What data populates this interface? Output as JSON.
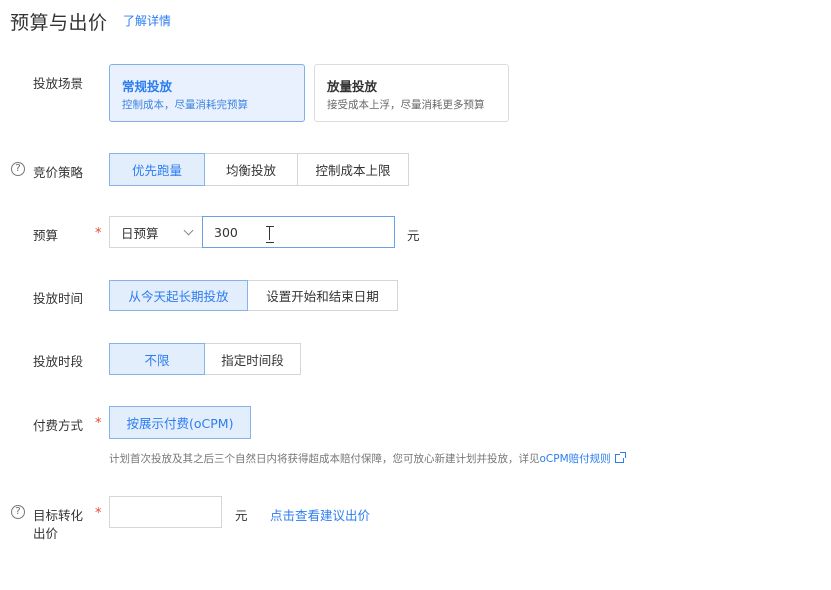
{
  "header": {
    "title": "预算与出价",
    "learn_more": "了解详情"
  },
  "scene": {
    "label": "投放场景",
    "options": [
      {
        "title": "常规投放",
        "subtitle": "控制成本，尽量消耗完预算"
      },
      {
        "title": "放量投放",
        "subtitle": "接受成本上浮，尽量消耗更多预算"
      }
    ],
    "selected": 0
  },
  "strategy": {
    "label": "竞价策略",
    "help_icon": "question-circle-icon",
    "options": [
      "优先跑量",
      "均衡投放",
      "控制成本上限"
    ],
    "selected": 0
  },
  "budget": {
    "label": "预算",
    "required_mark": "*",
    "select_value": "日预算",
    "input_value": "300",
    "unit": "元"
  },
  "schedule": {
    "label": "投放时间",
    "options": [
      "从今天起长期投放",
      "设置开始和结束日期"
    ],
    "selected": 0
  },
  "time_period": {
    "label": "投放时段",
    "options": [
      "不限",
      "指定时间段"
    ],
    "selected": 0
  },
  "payment": {
    "label": "付费方式",
    "required_mark": "*",
    "options": [
      "按展示付费(oCPM)"
    ],
    "selected": 0,
    "note": "计划首次投放及其之后三个自然日内将获得超成本赔付保障，您可放心新建计划并投放，详见",
    "note_link": "oCPM赔付规则"
  },
  "target_bid": {
    "label_line1": "目标转化",
    "label_line2": "出价",
    "required_mark": "*",
    "help_icon": "question-circle-icon",
    "input_value": "",
    "unit": "元",
    "suggest_link": "点击查看建议出价"
  }
}
